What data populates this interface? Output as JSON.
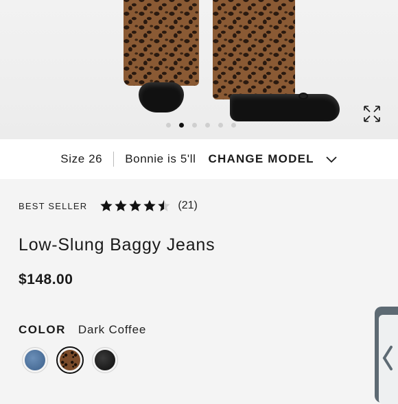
{
  "gallery": {
    "dots": [
      false,
      true,
      false,
      false,
      false,
      false
    ]
  },
  "model_bar": {
    "size": "Size 26",
    "model": "Bonnie is 5'll",
    "change_label": "CHANGE MODEL"
  },
  "product": {
    "badge": "BEST SELLER",
    "rating": 4.5,
    "review_count": "(21)",
    "title": "Low-Slung Baggy Jeans",
    "price": "$148.00",
    "color_label": "COLOR",
    "color_value": "Dark Coffee",
    "swatches": [
      "blue denim",
      "leopard",
      "black"
    ],
    "selected_swatch": "leopard"
  },
  "icons": {
    "expand": "expand-icon",
    "chevron": "chevron-down-icon",
    "star": "star-icon",
    "side_tab": "chevron-left-icon"
  },
  "colors": {
    "text": "#1a1a1a",
    "background": "#f4f4f4",
    "side_tab": "#5d6a73"
  }
}
